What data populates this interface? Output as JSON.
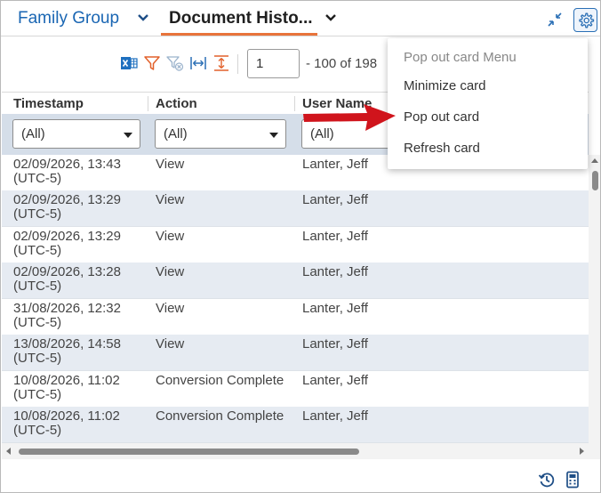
{
  "tabs": [
    {
      "label": "Family Group",
      "active": false
    },
    {
      "label": "Document Histo...",
      "active": true
    }
  ],
  "toolbar": {
    "page_value": "1",
    "page_range": "- 100 of 198"
  },
  "grid": {
    "columns": [
      "Timestamp",
      "Action",
      "User Name"
    ],
    "filters": [
      "(All)",
      "(All)",
      "(All)"
    ],
    "rows": [
      {
        "timestamp": "02/09/2026, 13:43 (UTC-5)",
        "action": "View",
        "user": "Lanter, Jeff"
      },
      {
        "timestamp": "02/09/2026, 13:29 (UTC-5)",
        "action": "View",
        "user": "Lanter, Jeff"
      },
      {
        "timestamp": "02/09/2026, 13:29 (UTC-5)",
        "action": "View",
        "user": "Lanter, Jeff"
      },
      {
        "timestamp": "02/09/2026, 13:28 (UTC-5)",
        "action": "View",
        "user": "Lanter, Jeff"
      },
      {
        "timestamp": "31/08/2026, 12:32 (UTC-5)",
        "action": "View",
        "user": "Lanter, Jeff"
      },
      {
        "timestamp": "13/08/2026, 14:58 (UTC-5)",
        "action": "View",
        "user": "Lanter, Jeff"
      },
      {
        "timestamp": "10/08/2026, 11:02 (UTC-5)",
        "action": "Conversion Complete",
        "user": "Lanter, Jeff"
      },
      {
        "timestamp": "10/08/2026, 11:02 (UTC-5)",
        "action": "Conversion Complete",
        "user": "Lanter, Jeff"
      }
    ]
  },
  "menu": {
    "title": "Pop out card Menu",
    "items": [
      "Minimize card",
      "Pop out card",
      "Refresh card"
    ]
  },
  "colors": {
    "accent_blue": "#1a66b3",
    "tab_underline": "#e8743b",
    "filter_row_bg": "#d5dee9",
    "alt_row_bg": "#e6ebf2",
    "annotation_arrow": "#d0141c"
  },
  "icons": [
    "chevron-down-icon",
    "collapse-icon",
    "gear-icon",
    "excel-export-icon",
    "filter-icon",
    "clear-filter-icon",
    "fit-width-icon",
    "fit-height-icon",
    "history-icon",
    "calculator-icon"
  ]
}
